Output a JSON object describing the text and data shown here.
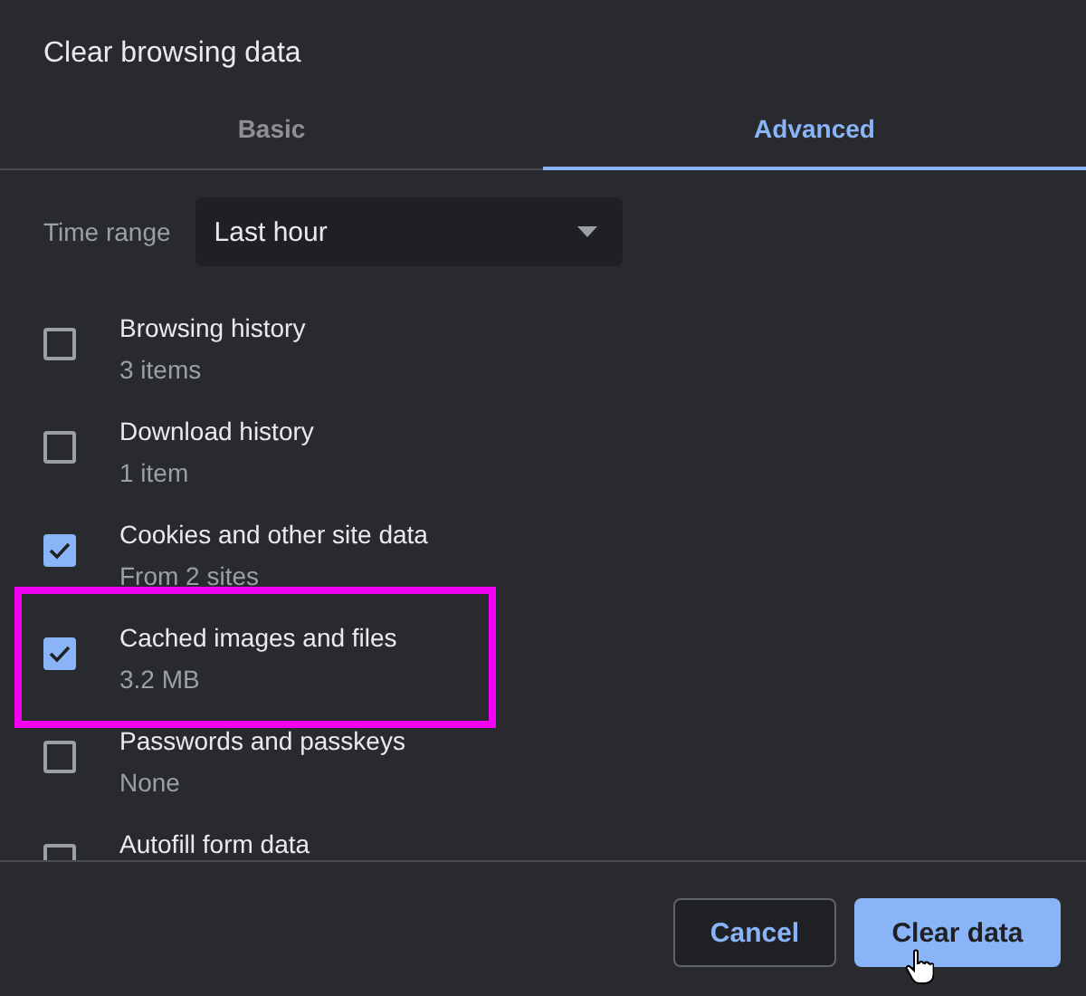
{
  "dialog": {
    "title": "Clear browsing data"
  },
  "tabs": [
    {
      "label": "Basic",
      "selected": false
    },
    {
      "label": "Advanced",
      "selected": true
    }
  ],
  "time_range": {
    "label": "Time range",
    "value": "Last hour"
  },
  "items": [
    {
      "label": "Browsing history",
      "detail": "3 items",
      "checked": false,
      "highlighted": false
    },
    {
      "label": "Download history",
      "detail": "1 item",
      "checked": false,
      "highlighted": false
    },
    {
      "label": "Cookies and other site data",
      "detail": "From 2 sites",
      "checked": true,
      "highlighted": false
    },
    {
      "label": "Cached images and files",
      "detail": "3.2 MB",
      "checked": true,
      "highlighted": true
    },
    {
      "label": "Passwords and passkeys",
      "detail": "None",
      "checked": false,
      "highlighted": false
    },
    {
      "label": "Autofill form data",
      "checked": false,
      "highlighted": false
    }
  ],
  "buttons": [
    {
      "label": "Cancel",
      "kind": "secondary"
    },
    {
      "label": "Clear data",
      "kind": "primary"
    }
  ]
}
